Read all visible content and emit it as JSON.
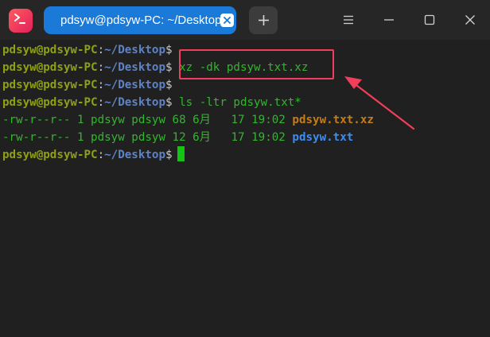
{
  "window": {
    "tab_title": "pdsyw@pdsyw-PC: ~/Desktop",
    "app_icon_glyph": ">_",
    "new_tab_glyph": "+"
  },
  "icons": {
    "app": "terminal-app-icon",
    "tab_close": "close-icon",
    "new_tab": "plus-icon",
    "menu": "hamburger-menu-icon",
    "minimize": "minimize-icon",
    "maximize": "maximize-icon",
    "close": "close-icon"
  },
  "colors": {
    "tab_active": "#1b7ad8",
    "user_host": "#8fa014",
    "path": "#5f83c4",
    "command": "#31b72d",
    "xz_file": "#c57d16",
    "txt_file": "#3d8df0",
    "cursor": "#14c414",
    "annotation": "#ef3f5b"
  },
  "terminal": {
    "lines": [
      {
        "user": "pdsyw@pdsyw-PC",
        "sep": ":",
        "path": "~/Desktop",
        "sign": "$",
        "cmd": ""
      },
      {
        "user": "pdsyw@pdsyw-PC",
        "sep": ":",
        "path": "~/Desktop",
        "sign": "$",
        "cmd": " xz -dk pdsyw.txt.xz"
      },
      {
        "user": "pdsyw@pdsyw-PC",
        "sep": ":",
        "path": "~/Desktop",
        "sign": "$",
        "cmd": ""
      },
      {
        "user": "pdsyw@pdsyw-PC",
        "sep": ":",
        "path": "~/Desktop",
        "sign": "$",
        "cmd": " ls -ltr pdsyw.txt*"
      },
      {
        "meta": "-rw-r--r-- 1 pdsyw pdsyw 68 6月   17 19:02 ",
        "file": "pdsyw.txt.xz"
      },
      {
        "meta": "-rw-r--r-- 1 pdsyw pdsyw 12 6月   17 19:02 ",
        "file": "pdsyw.txt"
      },
      {
        "user": "pdsyw@pdsyw-PC",
        "sep": ":",
        "path": "~/Desktop",
        "sign": "$",
        "cmd": ""
      }
    ]
  }
}
